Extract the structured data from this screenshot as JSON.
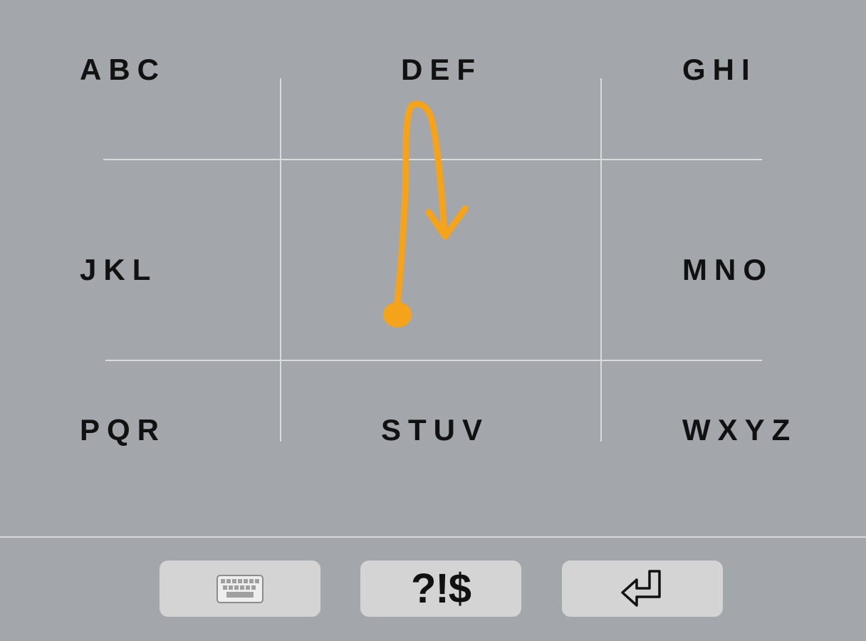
{
  "keypad": {
    "rows": [
      [
        "ABC",
        "DEF",
        "GHI"
      ],
      [
        "JKL",
        "MNO"
      ],
      [
        "PQR",
        "STUV",
        "WXYZ"
      ]
    ]
  },
  "toolbar": {
    "keyboard_icon": "keyboard-icon",
    "symbols_label": "?!$",
    "enter_icon": "enter-return-icon"
  },
  "colors": {
    "background": "#a3a7ab",
    "gridline": "#d9dbdd",
    "key_text": "#111111",
    "button_bg": "#d4d4d4",
    "gesture_stroke": "#f5a31a"
  }
}
